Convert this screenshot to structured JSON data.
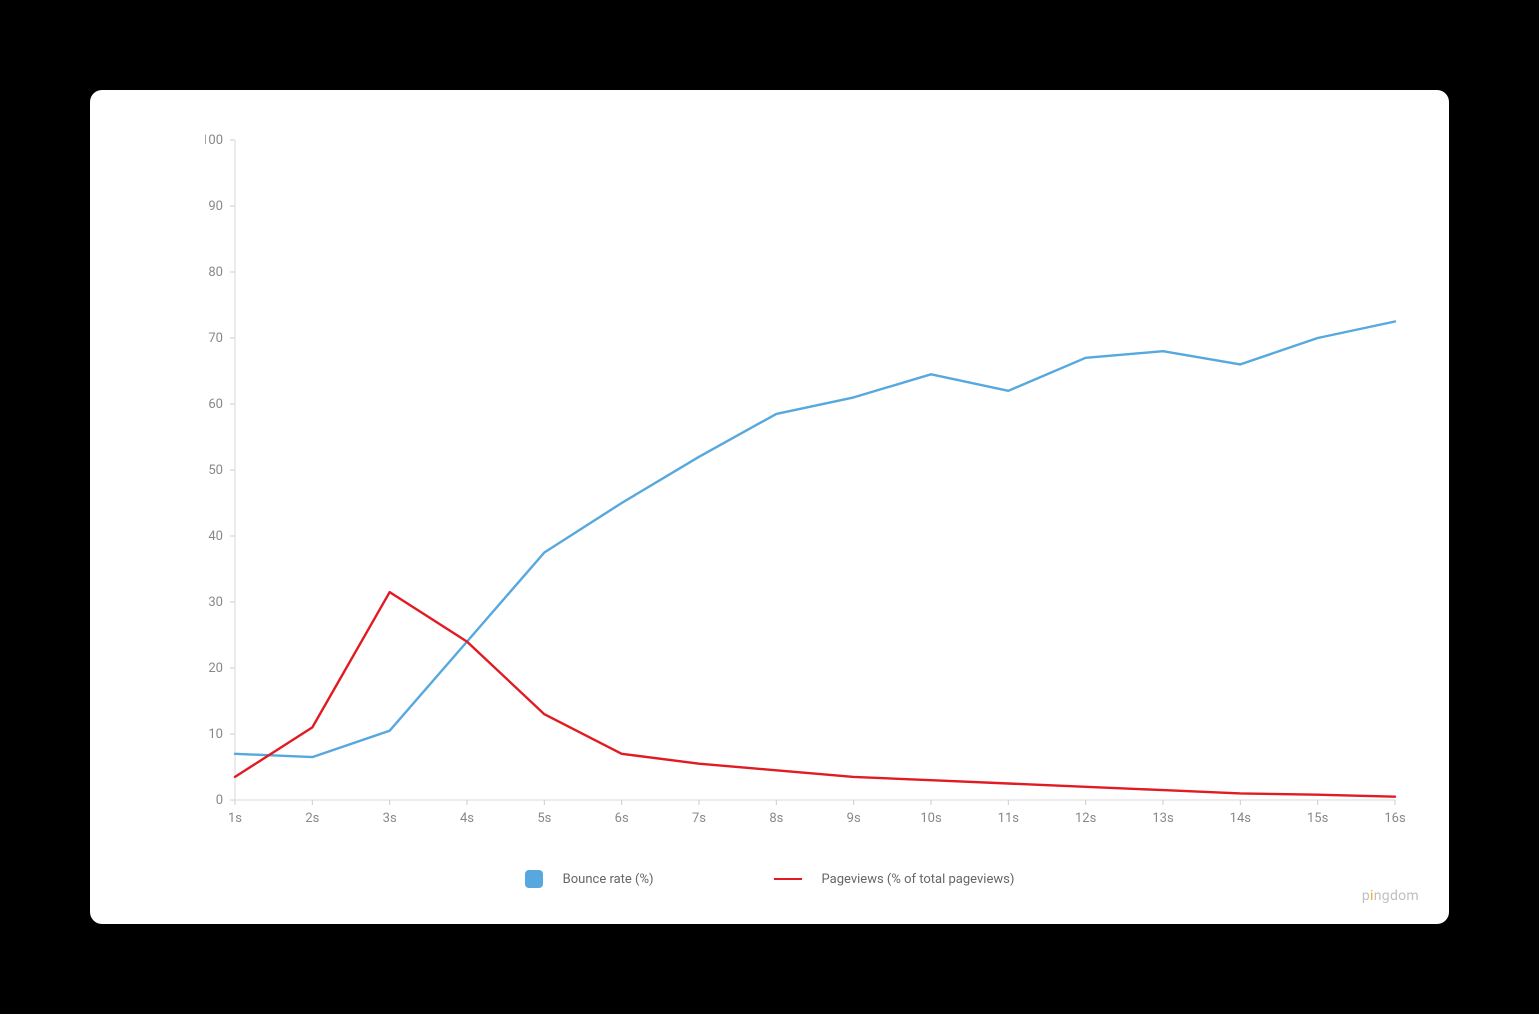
{
  "chart_data": {
    "type": "line",
    "categories": [
      "1s",
      "2s",
      "3s",
      "4s",
      "5s",
      "6s",
      "7s",
      "8s",
      "9s",
      "10s",
      "11s",
      "12s",
      "13s",
      "14s",
      "15s",
      "16s"
    ],
    "series": [
      {
        "name": "Bounce rate  (%)",
        "color": "#56a8de",
        "values": [
          7,
          6.5,
          10.5,
          24,
          37.5,
          45,
          52,
          58.5,
          61,
          64.5,
          62,
          67,
          68,
          66,
          70,
          72.5
        ]
      },
      {
        "name": "Pageviews (% of total pageviews)",
        "color": "#e11b22",
        "values": [
          3.5,
          11,
          31.5,
          24,
          13,
          7,
          5.5,
          4.5,
          3.5,
          3,
          2.5,
          2,
          1.5,
          1,
          0.8,
          0.5
        ]
      }
    ],
    "ylim": [
      0,
      100
    ],
    "y_ticks": [
      0,
      10,
      20,
      30,
      40,
      50,
      60,
      70,
      80,
      90,
      100
    ],
    "xlabel": "",
    "ylabel": "",
    "title": ""
  },
  "legend": {
    "items": [
      {
        "label": "Bounce rate  (%)"
      },
      {
        "label": "Pageviews (% of total pageviews)"
      }
    ]
  },
  "attribution": {
    "text": "pingdom"
  }
}
